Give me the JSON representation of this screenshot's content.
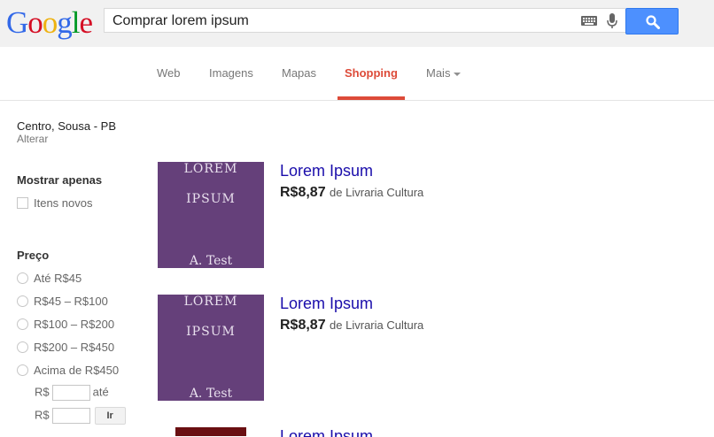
{
  "logo": {
    "letters": [
      "G",
      "o",
      "o",
      "g",
      "l",
      "e"
    ],
    "colors": [
      "#3369e8",
      "#d50f25",
      "#eeb211",
      "#3369e8",
      "#009925",
      "#d50f25"
    ]
  },
  "search": {
    "query": "Comprar lorem ipsum",
    "placeholder": ""
  },
  "icons": {
    "keyboard": "keyboard-icon",
    "mic": "microphone-icon",
    "search": "magnifier-icon"
  },
  "nav": {
    "tabs": [
      {
        "label": "Web"
      },
      {
        "label": "Imagens"
      },
      {
        "label": "Mapas"
      },
      {
        "label": "Shopping",
        "active": true
      },
      {
        "label": "Mais"
      }
    ]
  },
  "sidebar": {
    "location": "Centro, Sousa - PB",
    "change_location": "Alterar",
    "show_only_heading": "Mostrar apenas",
    "new_items_label": "Itens novos",
    "price_heading": "Preço",
    "price_options": [
      "Até R$45",
      "R$45 – R$100",
      "R$100 – R$200",
      "R$200 – R$450",
      "Acima de R$450"
    ],
    "range_currency_1": "R$",
    "range_to": "até",
    "range_currency_2": "R$",
    "go_button": "Ir"
  },
  "results": [
    {
      "title": "Lorem Ipsum",
      "price": "R$8,87",
      "seller": "de Livraria Cultura",
      "cover_line1": "LOREM",
      "cover_line2": "IPSUM",
      "cover_author": "A. Test"
    },
    {
      "title": "Lorem Ipsum",
      "price": "R$8,87",
      "seller": "de Livraria Cultura",
      "cover_line1": "LOREM",
      "cover_line2": "IPSUM",
      "cover_author": "A. Test"
    },
    {
      "title": "Lorem Ipsum"
    }
  ],
  "colors": {
    "accent": "#dd4b39",
    "link": "#1a0dab",
    "search_button": "#4d90fe",
    "cover": "#65407a"
  }
}
